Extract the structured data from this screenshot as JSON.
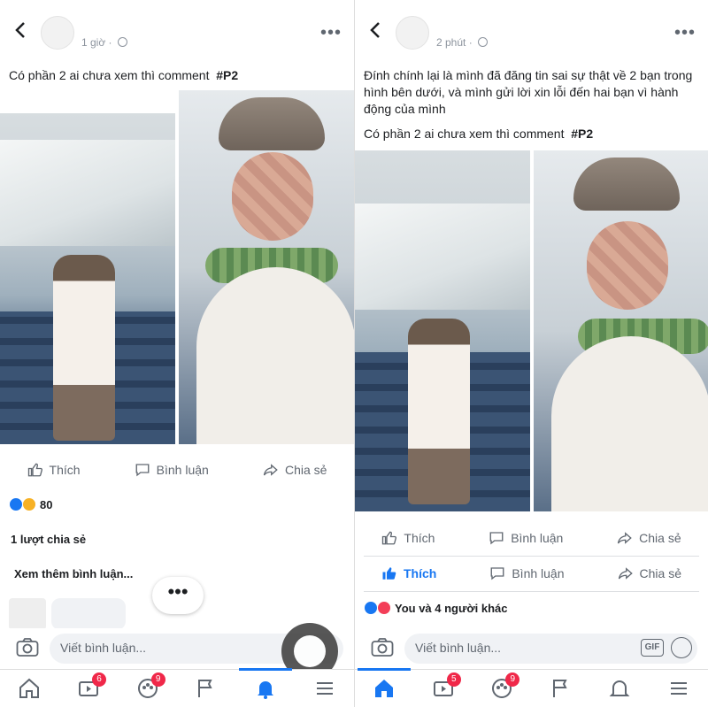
{
  "left": {
    "time": "1 giờ",
    "caption": "Có phần 2 ai chưa xem thì comment",
    "hashtag": "#P2",
    "actions": {
      "like": "Thích",
      "comment": "Bình luận",
      "share": "Chia sẻ"
    },
    "reaction_count": "80",
    "shares": "1 lượt chia sẻ",
    "more_comments": "Xem thêm bình luận...",
    "typing_indicator": "•••",
    "comment_placeholder": "Viết bình luận...",
    "badges": {
      "watch": "6",
      "groups": "9"
    }
  },
  "right": {
    "time": "2 phút",
    "caption_correction": "Đính chính lại là mình đã đăng tin sai sự thật về 2 bạn trong hình bên dưới, và mình gửi lời xin lỗi đến hai bạn vì hành động của mình",
    "caption": "Có phần 2 ai chưa xem thì comment",
    "hashtag": "#P2",
    "shared_actions": {
      "like": "Thích",
      "comment": "Bình luận",
      "share": "Chia sẻ"
    },
    "actions": {
      "like": "Thích",
      "comment": "Bình luận",
      "share": "Chia sẻ"
    },
    "reactions": "You và 4 người khác",
    "comment_placeholder": "Viết bình luận...",
    "gif": "GIF",
    "badges": {
      "watch": "5",
      "groups": "9"
    }
  },
  "colors": {
    "accent": "#1877f2",
    "badge": "#f02849"
  }
}
